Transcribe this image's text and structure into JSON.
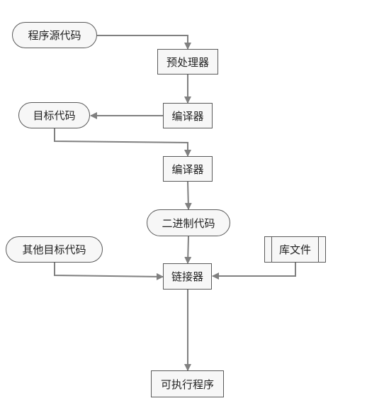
{
  "diagram": {
    "type": "flowchart",
    "line_color": "#808080",
    "node_fill": "#f7f7f7",
    "nodes": {
      "source": "程序源代码",
      "preprocessor": "预处理器",
      "compiler1": "编译器",
      "object_code": "目标代码",
      "compiler2": "编译器",
      "binary_code": "二进制代码",
      "other_object_code": "其他目标代码",
      "library": "库文件",
      "linker": "链接器",
      "executable": "可执行程序"
    },
    "edges": [
      [
        "source",
        "preprocessor"
      ],
      [
        "preprocessor",
        "compiler1"
      ],
      [
        "compiler1",
        "object_code"
      ],
      [
        "object_code",
        "compiler2"
      ],
      [
        "compiler2",
        "binary_code"
      ],
      [
        "binary_code",
        "linker"
      ],
      [
        "other_object_code",
        "linker"
      ],
      [
        "library",
        "linker"
      ],
      [
        "linker",
        "executable"
      ]
    ]
  }
}
